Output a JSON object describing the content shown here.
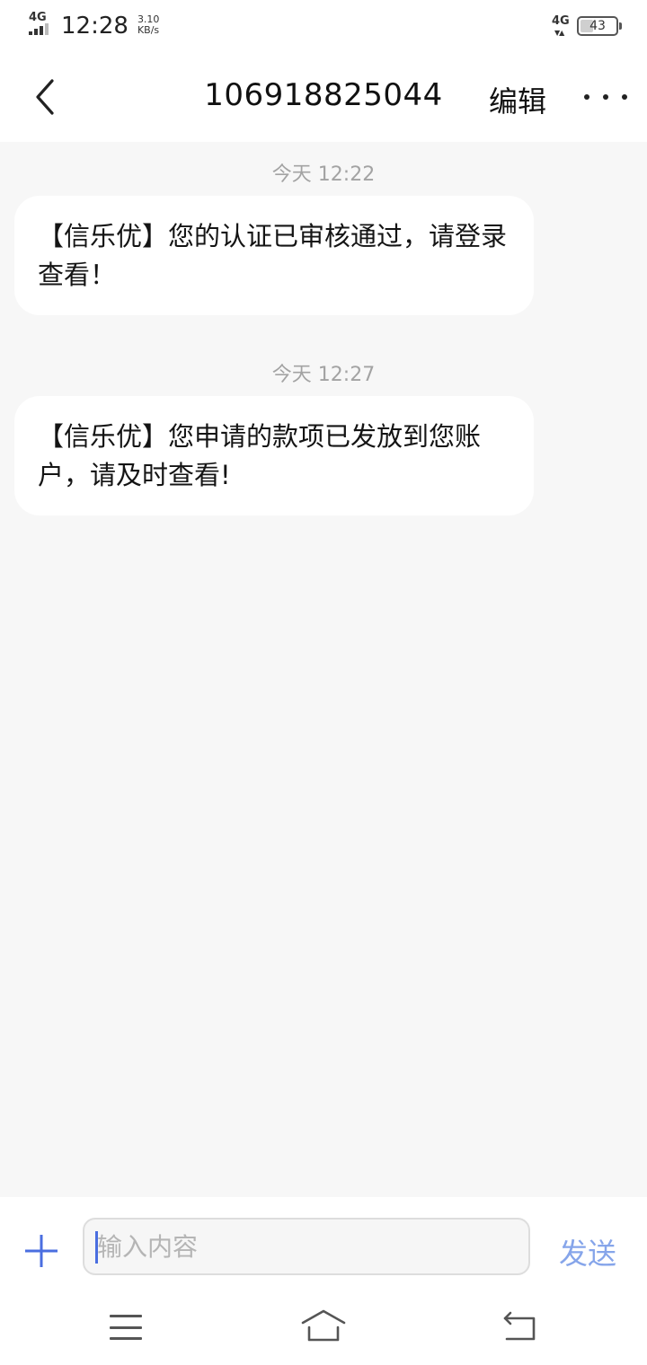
{
  "status_bar": {
    "network_left": "4G",
    "time": "12:28",
    "speed_value": "3.10",
    "speed_unit": "KB/s",
    "network_right": "4G",
    "battery": "43",
    "battery_level_percent": 43
  },
  "header": {
    "back_icon": "chevron-left-icon",
    "title": "106918825044",
    "edit_label": "编辑",
    "more_icon": "more-horizontal-icon"
  },
  "messages": [
    {
      "time": "今天 12:22",
      "text": "【信乐优】您的认证已审核通过，请登录查看！"
    },
    {
      "time": "今天 12:27",
      "text": "【信乐优】您申请的款项已发放到您账户，请及时查看!"
    }
  ],
  "composer": {
    "attach_icon": "plus-icon",
    "placeholder": "输入内容",
    "value": "",
    "send_label": "发送"
  },
  "nav_bar": {
    "menu_icon": "menu-icon",
    "home_icon": "home-icon",
    "back_icon": "back-arrow-icon"
  },
  "colors": {
    "accent": "#4a6ee0",
    "send_text": "#86a5ea",
    "background": "#f7f7f7",
    "bubble": "#ffffff",
    "timestamp": "#a3a3a3"
  }
}
